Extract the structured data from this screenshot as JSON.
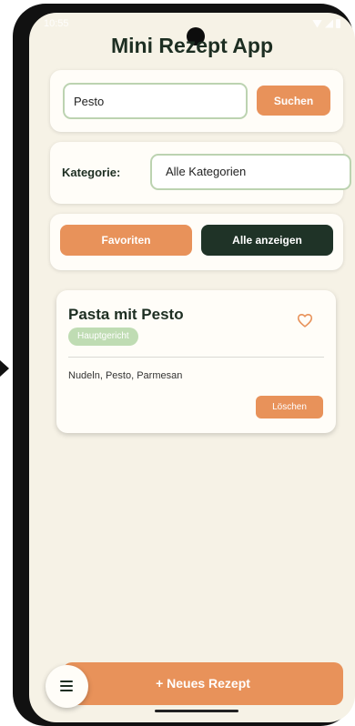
{
  "status": {
    "time": "10:55"
  },
  "app": {
    "title": "Mini Rezept App"
  },
  "search": {
    "value": "Pesto",
    "button_label": "Suchen"
  },
  "filter": {
    "label": "Kategorie:",
    "selected": "Alle Kategorien"
  },
  "actions": {
    "favorites_label": "Favoriten",
    "show_all_label": "Alle anzeigen"
  },
  "recipes": [
    {
      "title": "Pasta mit Pesto",
      "category": "Hauptgericht",
      "ingredients": "Nudeln, Pesto, Parmesan",
      "delete_label": "Löschen",
      "favorite_icon": "heart-outline-icon"
    }
  ],
  "bottom": {
    "new_recipe_label": "+ Neues Rezept",
    "menu_icon": "menu-icon"
  },
  "colors": {
    "accent": "#e8925a",
    "dark": "#1f3327",
    "background": "#f6f2e6",
    "badge": "#bfdcb3"
  }
}
